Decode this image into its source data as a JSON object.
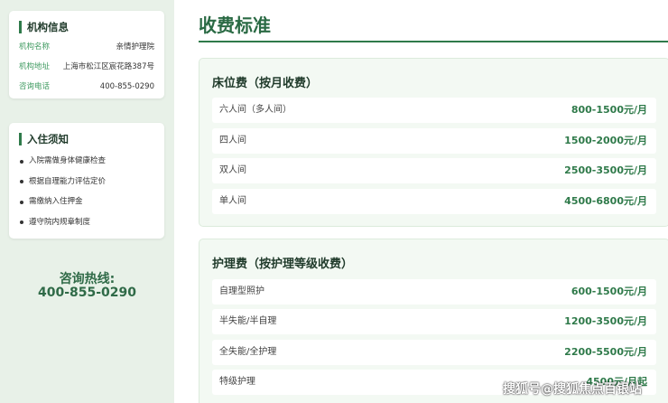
{
  "sidebar": {
    "info_card": {
      "title": "机构信息",
      "rows": [
        {
          "key": "机构名称",
          "value": "亲情护理院"
        },
        {
          "key": "机构地址",
          "value": "上海市松江区宸花路387号"
        },
        {
          "key": "咨询电话",
          "value": "400-855-0290"
        }
      ]
    },
    "notice_card": {
      "title": "入住须知",
      "items": [
        "入院需做身体健康检查",
        "根据自理能力评估定价",
        "需缴纳入住押金",
        "遵守院内规章制度"
      ]
    },
    "hotline": {
      "label": "咨询热线:",
      "number": "400-855-0290"
    }
  },
  "main": {
    "title": "收费标准",
    "sections": [
      {
        "title": "床位费（按月收费）",
        "rows": [
          {
            "name": "六人间（多人间）",
            "price": "800-1500元/月"
          },
          {
            "name": "四人间",
            "price": "1500-2000元/月"
          },
          {
            "name": "双人间",
            "price": "2500-3500元/月"
          },
          {
            "name": "单人间",
            "price": "4500-6800元/月"
          }
        ]
      },
      {
        "title": "护理费（按护理等级收费）",
        "rows": [
          {
            "name": "自理型照护",
            "price": "600-1500元/月"
          },
          {
            "name": "半失能/半自理",
            "price": "1200-3500元/月"
          },
          {
            "name": "全失能/全护理",
            "price": "2200-5500元/月"
          },
          {
            "name": "特级护理",
            "price": "4500元/月起"
          }
        ]
      }
    ]
  },
  "watermark": "搜狐号@搜狐焦点百银站",
  "colors": {
    "accent": "#2f7a4a",
    "sidebar_bg": "#e8f1e8",
    "section_bg": "#f3f9f3"
  }
}
